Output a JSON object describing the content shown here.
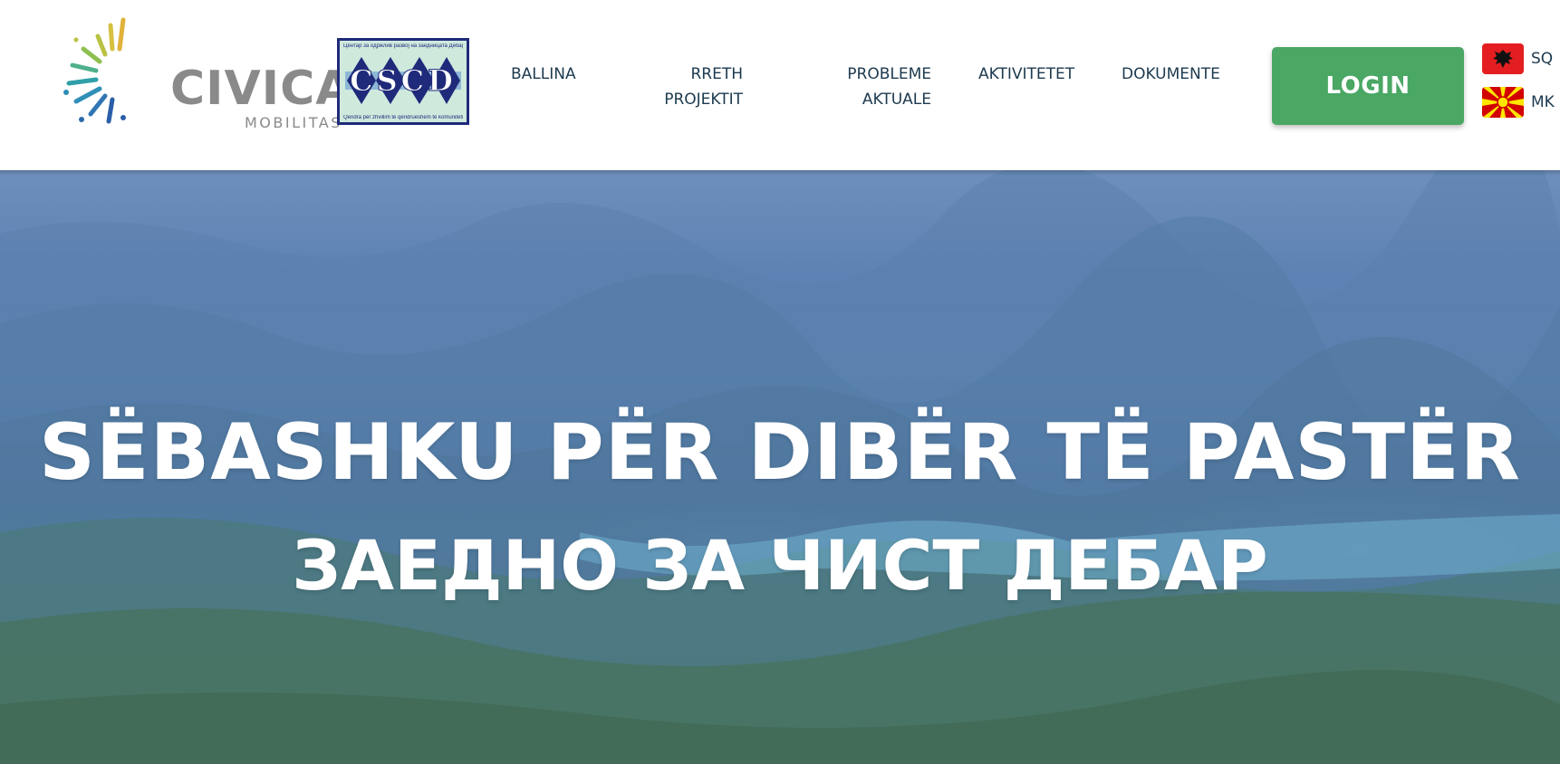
{
  "header": {
    "civica_logo": {
      "name": "CIVICA",
      "sub": "MOBILITAS"
    },
    "cscd_logo": {
      "letters": "CSCD",
      "top_text": "Центар за одржлив развој на заедницата Дебар",
      "bottom_text": "Qendra për zhvillim të qëndrueshëm të komunitetit Dibër"
    },
    "nav": [
      {
        "label": "BALLINA"
      },
      {
        "label_line1": "RRETH",
        "label_line2": "PROJEKTIT"
      },
      {
        "label_line1": "PROBLEME",
        "label_line2": "AKTUALE"
      },
      {
        "label": "AKTIVITETET"
      },
      {
        "label": "DOKUMENTE"
      }
    ],
    "login_label": "LOGIN",
    "languages": [
      {
        "code": "SQ",
        "flag": "albania-flag",
        "color": "#e41e20"
      },
      {
        "code": "MK",
        "flag": "macedonia-flag",
        "color": "#d20000"
      }
    ]
  },
  "hero": {
    "title_line1": "SËBASHKU PËR DIBËR TË PASTËR",
    "title_line2": "ЗАЕДНО ЗА ЧИСТ ДЕБАР"
  },
  "colors": {
    "accent_green": "#4aa764",
    "nav_text": "#1c3a4f",
    "logo_gray": "#8a8a8a"
  }
}
